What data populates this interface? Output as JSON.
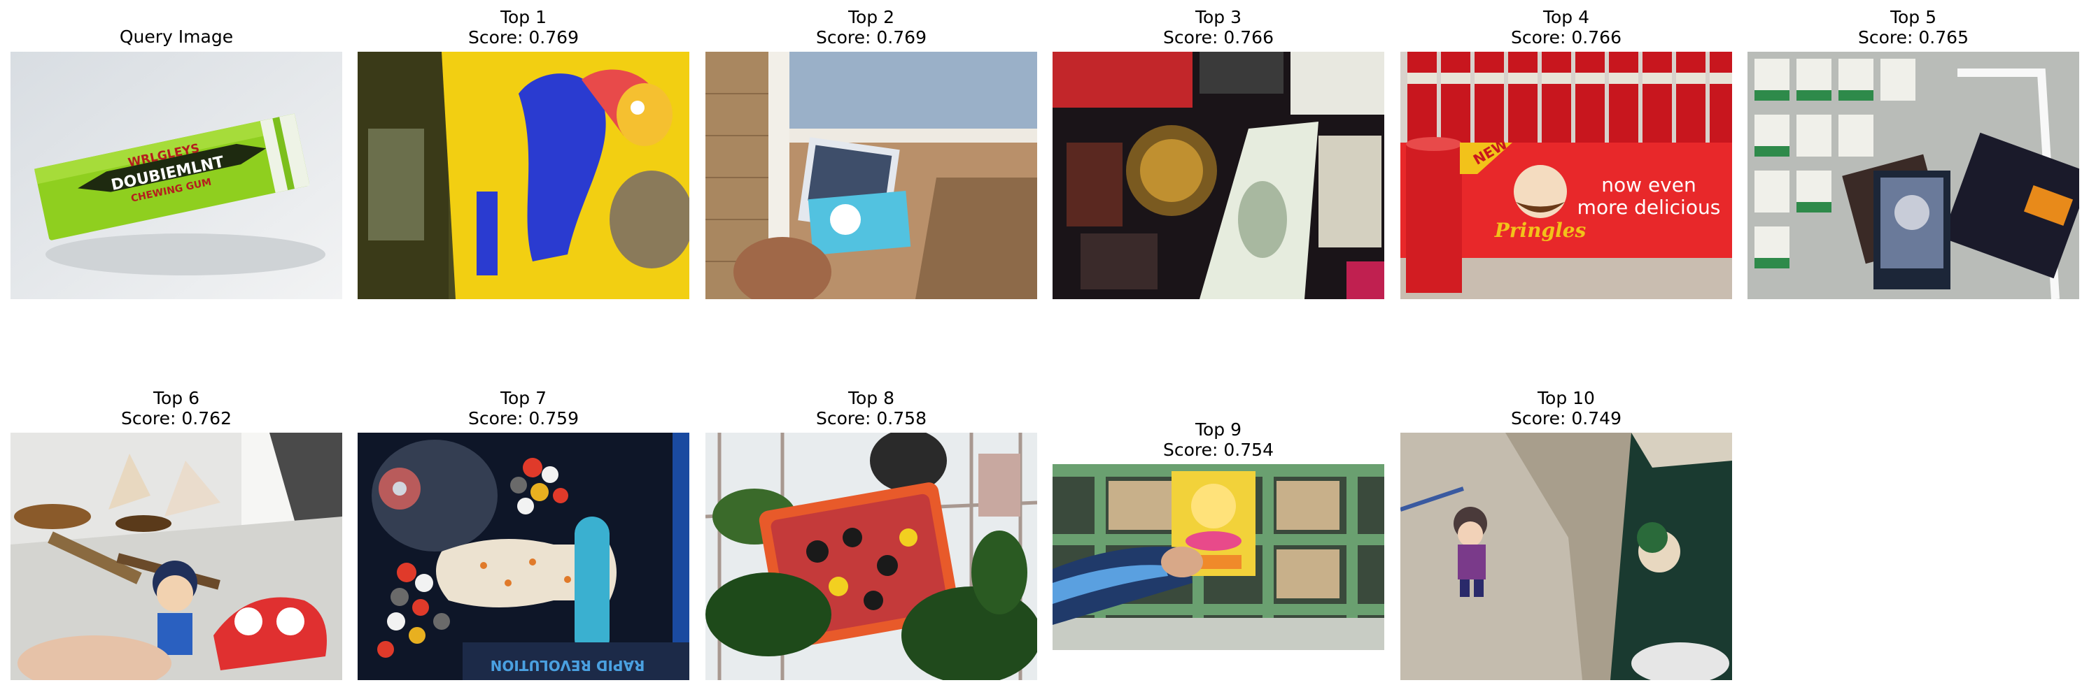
{
  "query": {
    "title": "Query Image",
    "gum_brand_line1": "WRLGLEYS",
    "gum_brand_line2": "DOUBIEMLNT",
    "gum_brand_line3": "CHEWING GUM"
  },
  "results": [
    {
      "rank_label": "Top 1",
      "score_label": "Score: 0.769"
    },
    {
      "rank_label": "Top 2",
      "score_label": "Score: 0.769"
    },
    {
      "rank_label": "Top 3",
      "score_label": "Score: 0.766"
    },
    {
      "rank_label": "Top 4",
      "score_label": "Score: 0.766",
      "sign_text_1": "now even",
      "sign_text_2": "more delicious",
      "brand": "Pringles",
      "badge": "NEW"
    },
    {
      "rank_label": "Top 5",
      "score_label": "Score: 0.765"
    },
    {
      "rank_label": "Top 6",
      "score_label": "Score: 0.762"
    },
    {
      "rank_label": "Top 7",
      "score_label": "Score: 0.759",
      "book_text": "RAPID REVOLUTION"
    },
    {
      "rank_label": "Top 8",
      "score_label": "Score: 0.758"
    },
    {
      "rank_label": "Top 9",
      "score_label": "Score: 0.754"
    },
    {
      "rank_label": "Top 10",
      "score_label": "Score: 0.749"
    }
  ]
}
